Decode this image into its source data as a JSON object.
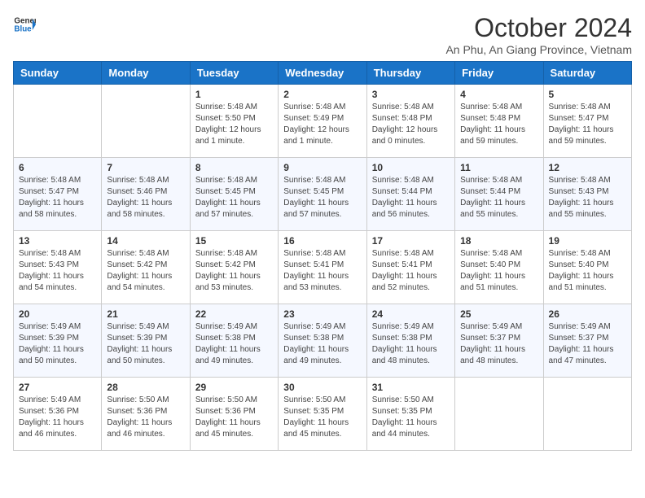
{
  "logo": {
    "line1": "General",
    "line2": "Blue"
  },
  "title": "October 2024",
  "subtitle": "An Phu, An Giang Province, Vietnam",
  "weekdays": [
    "Sunday",
    "Monday",
    "Tuesday",
    "Wednesday",
    "Thursday",
    "Friday",
    "Saturday"
  ],
  "weeks": [
    [
      {
        "day": "",
        "info": ""
      },
      {
        "day": "",
        "info": ""
      },
      {
        "day": "1",
        "info": "Sunrise: 5:48 AM\nSunset: 5:50 PM\nDaylight: 12 hours and 1 minute."
      },
      {
        "day": "2",
        "info": "Sunrise: 5:48 AM\nSunset: 5:49 PM\nDaylight: 12 hours and 1 minute."
      },
      {
        "day": "3",
        "info": "Sunrise: 5:48 AM\nSunset: 5:48 PM\nDaylight: 12 hours and 0 minutes."
      },
      {
        "day": "4",
        "info": "Sunrise: 5:48 AM\nSunset: 5:48 PM\nDaylight: 11 hours and 59 minutes."
      },
      {
        "day": "5",
        "info": "Sunrise: 5:48 AM\nSunset: 5:47 PM\nDaylight: 11 hours and 59 minutes."
      }
    ],
    [
      {
        "day": "6",
        "info": "Sunrise: 5:48 AM\nSunset: 5:47 PM\nDaylight: 11 hours and 58 minutes."
      },
      {
        "day": "7",
        "info": "Sunrise: 5:48 AM\nSunset: 5:46 PM\nDaylight: 11 hours and 58 minutes."
      },
      {
        "day": "8",
        "info": "Sunrise: 5:48 AM\nSunset: 5:45 PM\nDaylight: 11 hours and 57 minutes."
      },
      {
        "day": "9",
        "info": "Sunrise: 5:48 AM\nSunset: 5:45 PM\nDaylight: 11 hours and 57 minutes."
      },
      {
        "day": "10",
        "info": "Sunrise: 5:48 AM\nSunset: 5:44 PM\nDaylight: 11 hours and 56 minutes."
      },
      {
        "day": "11",
        "info": "Sunrise: 5:48 AM\nSunset: 5:44 PM\nDaylight: 11 hours and 55 minutes."
      },
      {
        "day": "12",
        "info": "Sunrise: 5:48 AM\nSunset: 5:43 PM\nDaylight: 11 hours and 55 minutes."
      }
    ],
    [
      {
        "day": "13",
        "info": "Sunrise: 5:48 AM\nSunset: 5:43 PM\nDaylight: 11 hours and 54 minutes."
      },
      {
        "day": "14",
        "info": "Sunrise: 5:48 AM\nSunset: 5:42 PM\nDaylight: 11 hours and 54 minutes."
      },
      {
        "day": "15",
        "info": "Sunrise: 5:48 AM\nSunset: 5:42 PM\nDaylight: 11 hours and 53 minutes."
      },
      {
        "day": "16",
        "info": "Sunrise: 5:48 AM\nSunset: 5:41 PM\nDaylight: 11 hours and 53 minutes."
      },
      {
        "day": "17",
        "info": "Sunrise: 5:48 AM\nSunset: 5:41 PM\nDaylight: 11 hours and 52 minutes."
      },
      {
        "day": "18",
        "info": "Sunrise: 5:48 AM\nSunset: 5:40 PM\nDaylight: 11 hours and 51 minutes."
      },
      {
        "day": "19",
        "info": "Sunrise: 5:48 AM\nSunset: 5:40 PM\nDaylight: 11 hours and 51 minutes."
      }
    ],
    [
      {
        "day": "20",
        "info": "Sunrise: 5:49 AM\nSunset: 5:39 PM\nDaylight: 11 hours and 50 minutes."
      },
      {
        "day": "21",
        "info": "Sunrise: 5:49 AM\nSunset: 5:39 PM\nDaylight: 11 hours and 50 minutes."
      },
      {
        "day": "22",
        "info": "Sunrise: 5:49 AM\nSunset: 5:38 PM\nDaylight: 11 hours and 49 minutes."
      },
      {
        "day": "23",
        "info": "Sunrise: 5:49 AM\nSunset: 5:38 PM\nDaylight: 11 hours and 49 minutes."
      },
      {
        "day": "24",
        "info": "Sunrise: 5:49 AM\nSunset: 5:38 PM\nDaylight: 11 hours and 48 minutes."
      },
      {
        "day": "25",
        "info": "Sunrise: 5:49 AM\nSunset: 5:37 PM\nDaylight: 11 hours and 48 minutes."
      },
      {
        "day": "26",
        "info": "Sunrise: 5:49 AM\nSunset: 5:37 PM\nDaylight: 11 hours and 47 minutes."
      }
    ],
    [
      {
        "day": "27",
        "info": "Sunrise: 5:49 AM\nSunset: 5:36 PM\nDaylight: 11 hours and 46 minutes."
      },
      {
        "day": "28",
        "info": "Sunrise: 5:50 AM\nSunset: 5:36 PM\nDaylight: 11 hours and 46 minutes."
      },
      {
        "day": "29",
        "info": "Sunrise: 5:50 AM\nSunset: 5:36 PM\nDaylight: 11 hours and 45 minutes."
      },
      {
        "day": "30",
        "info": "Sunrise: 5:50 AM\nSunset: 5:35 PM\nDaylight: 11 hours and 45 minutes."
      },
      {
        "day": "31",
        "info": "Sunrise: 5:50 AM\nSunset: 5:35 PM\nDaylight: 11 hours and 44 minutes."
      },
      {
        "day": "",
        "info": ""
      },
      {
        "day": "",
        "info": ""
      }
    ]
  ]
}
